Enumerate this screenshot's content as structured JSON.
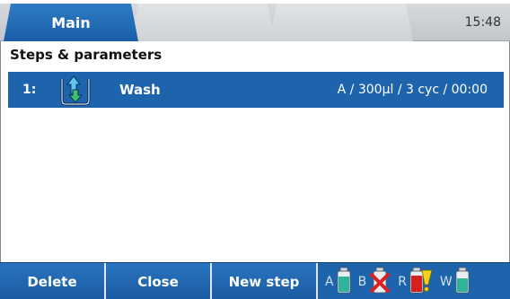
{
  "tabs": {
    "main_label": "Main",
    "clock": "15:48"
  },
  "section_title": "Steps & parameters",
  "steps": [
    {
      "number": "1:",
      "icon": "wash-icon",
      "name": "Wash",
      "params": "A / 300µl / 3 cyc / 00:00"
    }
  ],
  "footer": {
    "delete_label": "Delete",
    "close_label": "Close",
    "new_step_label": "New step",
    "bottles": [
      {
        "letter": "A",
        "icon": "bottle-green-icon"
      },
      {
        "letter": "B",
        "icon": "bottle-unavailable-icon"
      },
      {
        "letter": "R",
        "icon": "bottle-red-warning-icon"
      },
      {
        "letter": "W",
        "icon": "bottle-green-icon"
      }
    ]
  },
  "colors": {
    "accent": "#1d64ad",
    "selection": "#1d64ad",
    "bottle_green": "#2fb39a",
    "bottle_red": "#d62020",
    "warning_yellow": "#f2d21a"
  }
}
